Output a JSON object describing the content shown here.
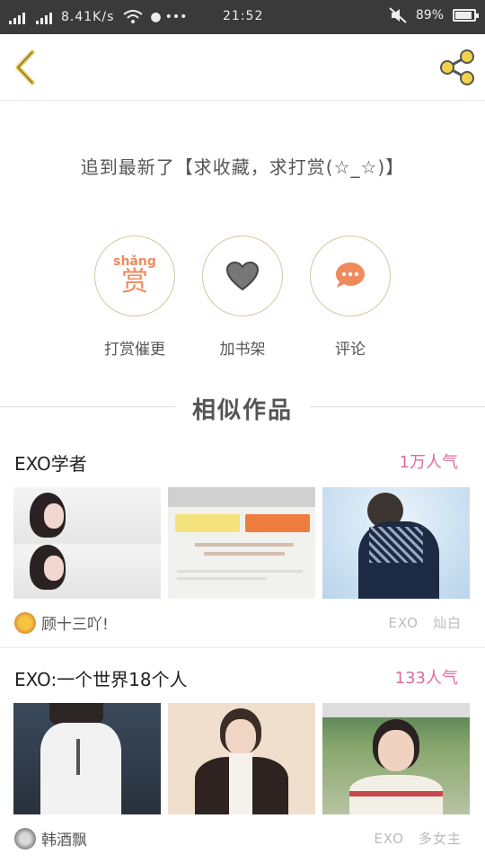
{
  "status": {
    "net_speed": "8.41K/s",
    "time": "21:52",
    "battery": "89%",
    "battery_level": 0.89
  },
  "chapter": {
    "text": "追到最新了【求收藏，求打赏(☆_☆)】"
  },
  "actions": {
    "reward_pinyin": "shǎng",
    "reward_char": "赏",
    "reward_label": "打赏催更",
    "shelf_label": "加书架",
    "comment_label": "评论"
  },
  "similar": {
    "heading": "相似作品",
    "books": [
      {
        "title": "EXO学者",
        "popularity": "1万人气",
        "author": "顾十三吖!",
        "tag1": "EXO",
        "tag2": "灿白"
      },
      {
        "title": "EXO:一个世界18个人",
        "popularity": "133人气",
        "author": "韩酒飘",
        "tag1": "EXO",
        "tag2": "多女主"
      }
    ]
  },
  "icons": {
    "back": "chevron-left-icon",
    "share": "share-icon",
    "shelf": "heart-icon",
    "comment": "chat-bubble-icon"
  },
  "colors": {
    "accent": "#e8c547",
    "reward": "#f08a5d",
    "popularity": "#e06aa0"
  }
}
